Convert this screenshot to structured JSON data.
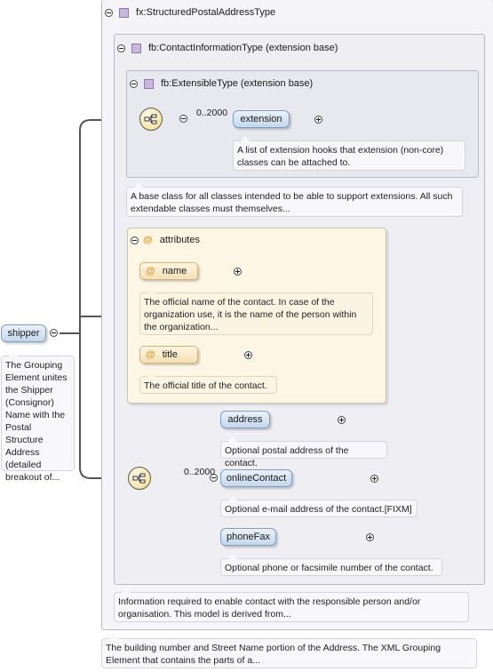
{
  "root": {
    "label": "shipper",
    "doc": "The Grouping Element unites the Shipper (Consignor) Name with the Postal Structure Address (detailed breakout of..."
  },
  "types": {
    "postal": "fx:StructuredPostalAddressType",
    "contact": "fb:ContactInformationType (extension base)",
    "extensible": "fb:ExtensibleType (extension base)"
  },
  "extensible_group": {
    "occurrence": "0..2000",
    "element": "extension",
    "element_doc": "A list of extension hooks that extension (non-core) classes can be attached to.",
    "type_doc": "A base class for all classes intended to be able to support extensions. All such extendable classes must themselves..."
  },
  "attributes": {
    "header": "attributes",
    "items": [
      {
        "name": "name",
        "doc": "The official name of the contact. In case of the organization use, it is the name of the person within the organization..."
      },
      {
        "name": "title",
        "doc": "The official title of the contact."
      }
    ]
  },
  "contact_group": {
    "occurrence": "0..2000",
    "elements": [
      {
        "name": "address",
        "doc": "Optional postal address of the contact."
      },
      {
        "name": "onlineContact",
        "doc": "Optional e-mail address of the contact.[FIXM]"
      },
      {
        "name": "phoneFax",
        "doc": "Optional phone or facsimile number of the contact."
      }
    ],
    "type_doc": "Information required to enable contact with the responsible person and/or organisation. This model is derived from..."
  },
  "postal_doc": "The building number and Street Name portion of the Address. The XML Grouping Element that contains the parts of a...",
  "icons": {
    "collapse": "minus-circle-icon",
    "expand": "plus-circle-icon",
    "complex_type": "complex-type-icon",
    "sequence": "sequence-compositor-icon",
    "attribute": "attribute-at-icon"
  },
  "colors": {
    "element_fill": "#c5d7ec",
    "attribute_fill": "#fdf6e4",
    "compositor_fill": "#f1d98a",
    "type_icon": "#c8b8dc"
  }
}
